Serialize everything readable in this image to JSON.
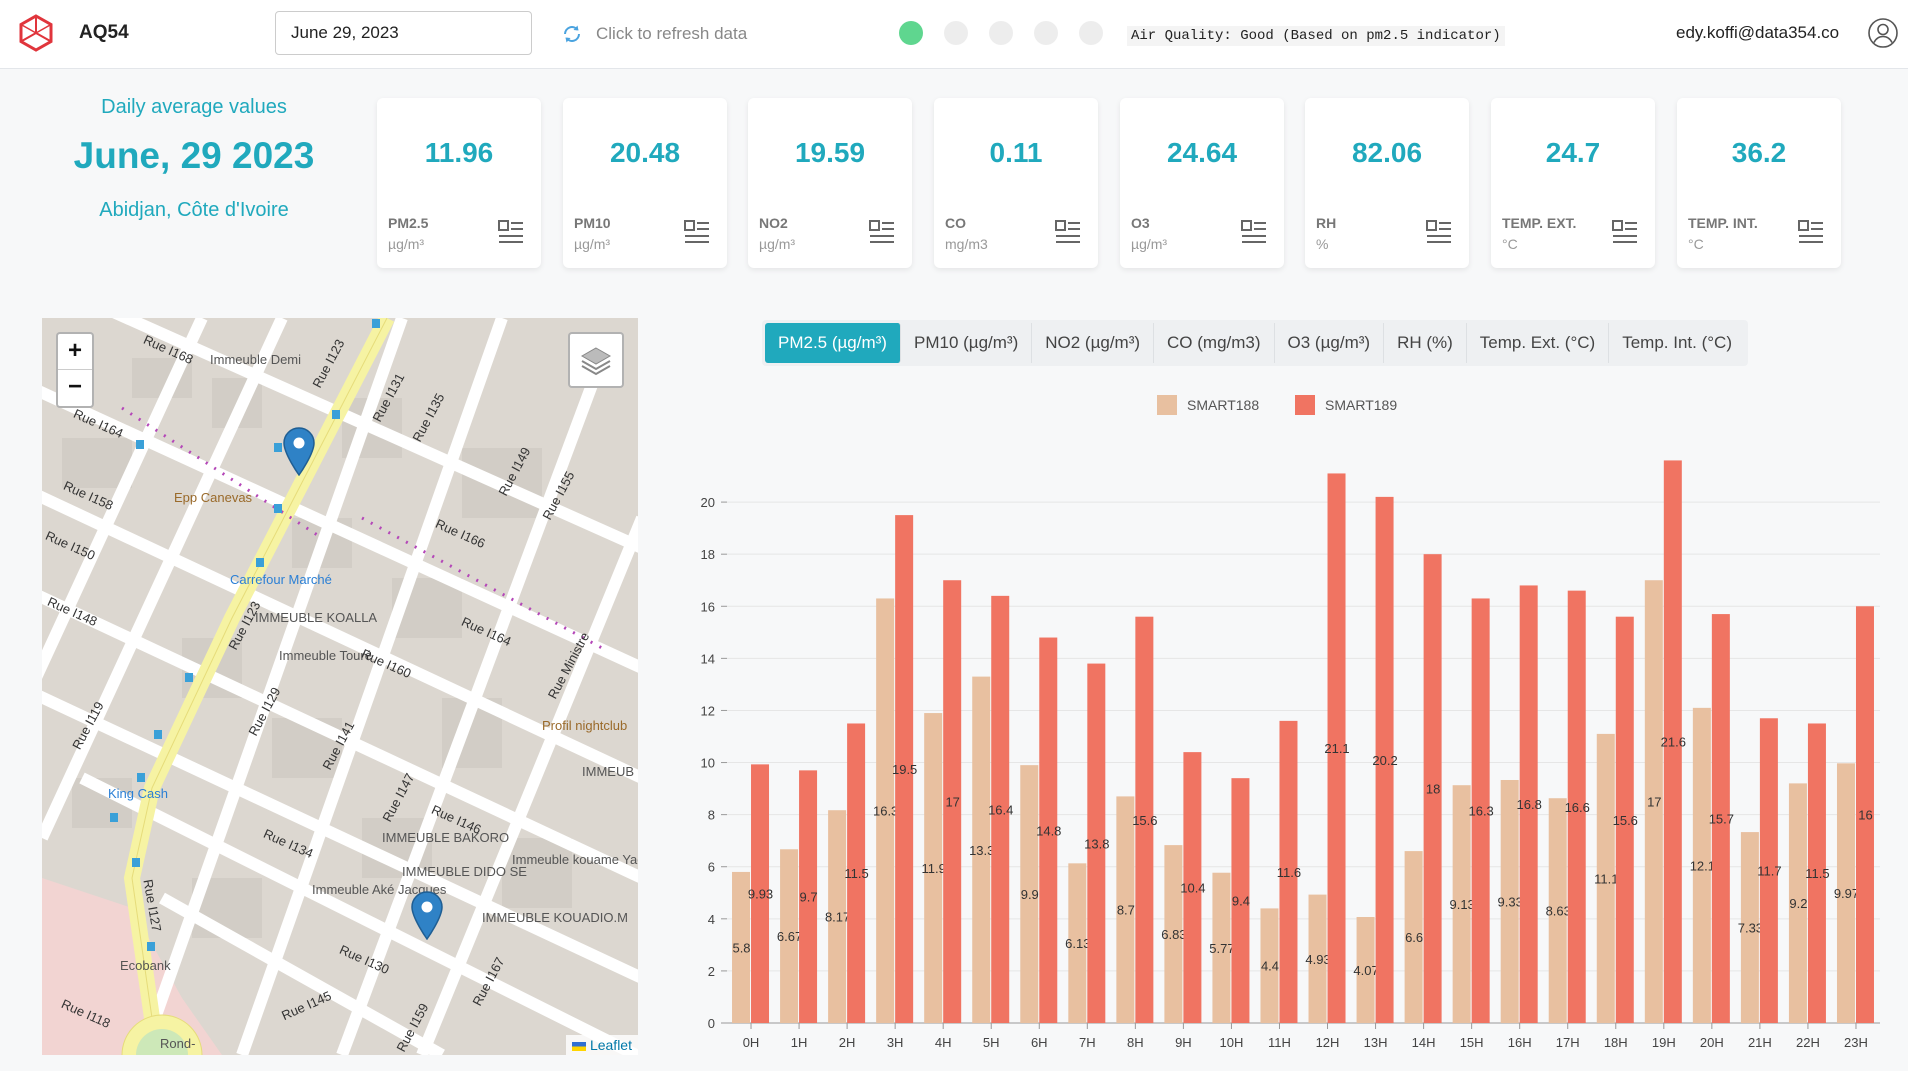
{
  "header": {
    "app_name": "AQ54",
    "date_value": "June 29, 2023",
    "refresh_label": "Click to refresh data",
    "air_quality_status": "Air Quality: Good (Based on pm2.5 indicator)",
    "user_email": "edy.koffi@data354.co"
  },
  "summary": {
    "subtitle": "Daily average values",
    "date": "June, 29 2023",
    "location": "Abidjan, Côte d'Ivoire"
  },
  "cards": [
    {
      "value": "11.96",
      "name": "PM2.5",
      "unit": "µg/m³"
    },
    {
      "value": "20.48",
      "name": "PM10",
      "unit": "µg/m³"
    },
    {
      "value": "19.59",
      "name": "NO2",
      "unit": "µg/m³"
    },
    {
      "value": "0.11",
      "name": "CO",
      "unit": "mg/m3"
    },
    {
      "value": "24.64",
      "name": "O3",
      "unit": "µg/m³"
    },
    {
      "value": "82.06",
      "name": "RH",
      "unit": "%"
    },
    {
      "value": "24.7",
      "name": "TEMP. EXT.",
      "unit": "°C"
    },
    {
      "value": "36.2",
      "name": "TEMP. INT.",
      "unit": "°C"
    }
  ],
  "map": {
    "zoom_in": "+",
    "zoom_out": "−",
    "attribution": "Leaflet",
    "labels": {
      "immeuble_demi": "Immeuble Demi",
      "epp_canevas": "Epp Canevas",
      "carrefour": "Carrefour Marché",
      "immeuble_koalla": "IMMEUBLE KOALLA",
      "immeuble_toure": "Immeuble Touré",
      "profil": "Profil nightclub",
      "king_cash": "King Cash",
      "immeuble_bakoro": "IMMEUBLE BAKORO",
      "immeuble_dido": "IMMEUBLE DIDO SE",
      "immeuble_ake": "Immeuble Aké Jacques",
      "immeuble_kouame": "Immeuble kouame Yao",
      "immeuble_kouadio": "IMMEUBLE KOUADIO.M",
      "immeuble_diawar": "IMMEUB DIAWAR",
      "ecobank": "Ecobank",
      "rond_point": "Rond-",
      "rue_1168": "Rue I168",
      "rue_1164a": "Rue I164",
      "rue_1158": "Rue I158",
      "rue_1150": "Rue I150",
      "rue_1148": "Rue I148",
      "rue_1119": "Rue I119",
      "rue_1123": "Rue I123",
      "rue_1131": "Rue I131",
      "rue_1135": "Rue I135",
      "rue_1149": "Rue I149",
      "rue_1155": "Rue I155",
      "rue_1166": "Rue I166",
      "rue_1164b": "Rue I164",
      "rue_1160": "Rue I160",
      "rue_1129": "Rue I129",
      "rue_1141": "Rue I141",
      "rue_1147": "Rue I147",
      "rue_1146": "Rue I146",
      "rue_1134": "Rue I134",
      "rue_1130": "Rue I130",
      "rue_1145": "Rue I145",
      "rue_1118": "Rue I118",
      "rue_1127": "Rue I127",
      "rue_1167": "Rue I167",
      "rue_1159": "Rue I159",
      "rue_ministre": "Rue Ministre",
      "rue_1123b": "Rue I123"
    }
  },
  "tabs": [
    {
      "label": "PM2.5 (µg/m³)",
      "active": true
    },
    {
      "label": "PM10 (µg/m³)",
      "active": false
    },
    {
      "label": "NO2 (µg/m³)",
      "active": false
    },
    {
      "label": "CO (mg/m3)",
      "active": false
    },
    {
      "label": "O3 (µg/m³)",
      "active": false
    },
    {
      "label": "RH (%)",
      "active": false
    },
    {
      "label": "Temp. Ext. (°C)",
      "active": false
    },
    {
      "label": "Temp. Int. (°C)",
      "active": false
    }
  ],
  "colors": {
    "accent": "#20a9bd",
    "smart188": "#e8c0a0",
    "smart189": "#f07462",
    "good_dot": "#5fd68f"
  },
  "chart_data": {
    "type": "bar",
    "categories": [
      "0H",
      "1H",
      "2H",
      "3H",
      "4H",
      "5H",
      "6H",
      "7H",
      "8H",
      "9H",
      "10H",
      "11H",
      "12H",
      "13H",
      "14H",
      "15H",
      "16H",
      "17H",
      "18H",
      "19H",
      "20H",
      "21H",
      "22H",
      "23H"
    ],
    "series": [
      {
        "name": "SMART188",
        "values": [
          5.8,
          6.67,
          8.17,
          16.3,
          11.9,
          13.3,
          9.9,
          6.13,
          8.7,
          6.83,
          5.77,
          4.4,
          4.93,
          4.07,
          6.6,
          9.13,
          9.33,
          8.63,
          11.1,
          17,
          12.1,
          7.33,
          9.2,
          9.97
        ],
        "labels": [
          "5.8",
          "6.67",
          "8.17",
          "16.3",
          "11.9",
          "13.3",
          "9.9",
          "6.13",
          "8.7",
          "6.83",
          "5.77",
          "4.4",
          "4.93",
          "4.07",
          "6.6",
          "9.13",
          "9.33",
          "8.63",
          "11.1",
          "17",
          "12.1",
          "7.33",
          "9.2",
          "9.97"
        ]
      },
      {
        "name": "SMART189",
        "values": [
          9.93,
          9.7,
          11.5,
          19.5,
          17,
          16.4,
          14.8,
          13.8,
          15.6,
          10.4,
          9.4,
          11.6,
          21.1,
          20.2,
          18,
          16.3,
          16.8,
          16.6,
          15.6,
          21.6,
          15.7,
          11.7,
          11.5,
          16
        ],
        "labels": [
          "9.93",
          "9.7",
          "11.5",
          "19.5",
          "17",
          "16.4",
          "14.8",
          "13.8",
          "15.6",
          "10.4",
          "9.4",
          "11.6",
          "21.1",
          "20.2",
          "18",
          "16.3",
          "16.8",
          "16.6",
          "15.6",
          "21.6",
          "15.7",
          "11.7",
          "11.5",
          "16"
        ]
      }
    ],
    "ylim": [
      0,
      22
    ],
    "yticks": [
      0,
      2,
      4,
      6,
      8,
      10,
      12,
      14,
      16,
      18,
      20
    ],
    "grid": true,
    "legend": "top-center"
  }
}
